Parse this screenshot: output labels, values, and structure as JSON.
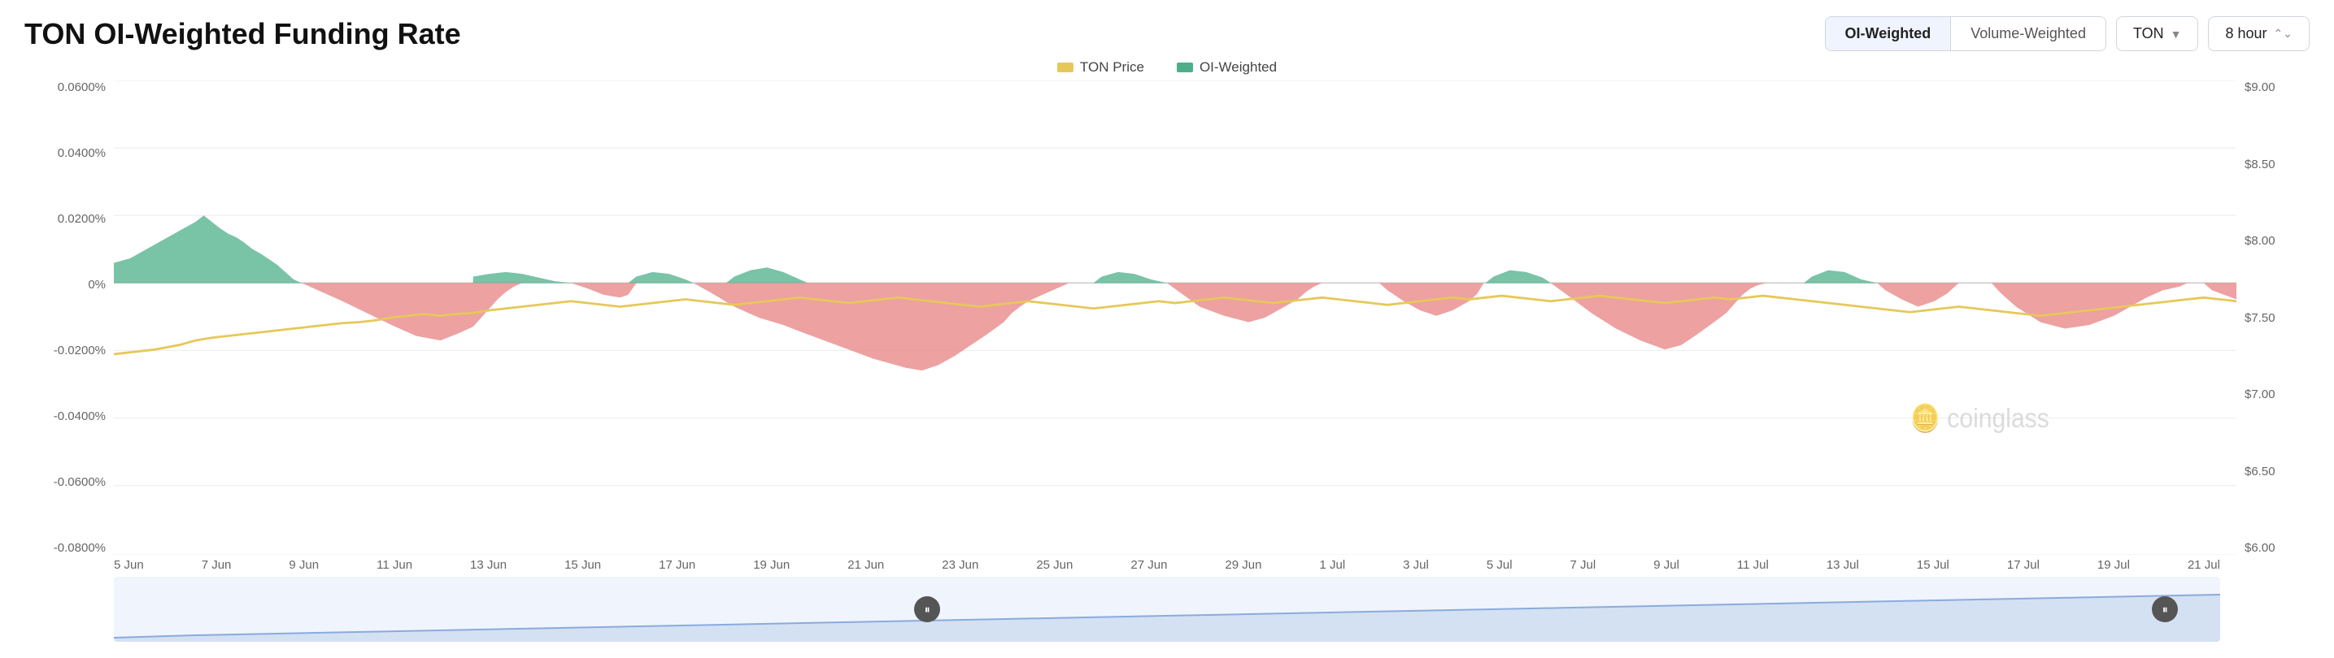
{
  "title": "TON OI-Weighted Funding Rate",
  "controls": {
    "tab_oi": "OI-Weighted",
    "tab_volume": "Volume-Weighted",
    "dropdown_asset": "TON",
    "dropdown_period": "8 hour",
    "active_tab": "oi"
  },
  "legend": {
    "items": [
      {
        "label": "TON Price",
        "color": "#e6c85a"
      },
      {
        "label": "OI-Weighted",
        "color": "#4caf8a"
      }
    ]
  },
  "y_axis_left": [
    "0.0600%",
    "0.0400%",
    "0.0200%",
    "0%",
    "-0.0200%",
    "-0.0400%",
    "-0.0600%",
    "-0.0800%"
  ],
  "y_axis_right": [
    "$9.00",
    "$8.50",
    "$8.00",
    "$7.50",
    "$7.00",
    "$6.50",
    "$6.00"
  ],
  "x_axis": [
    "5 Jun",
    "7 Jun",
    "9 Jun",
    "11 Jun",
    "13 Jun",
    "15 Jun",
    "17 Jun",
    "19 Jun",
    "21 Jun",
    "23 Jun",
    "25 Jun",
    "27 Jun",
    "29 Jun",
    "1 Jul",
    "3 Jul",
    "5 Jul",
    "7 Jul",
    "9 Jul",
    "11 Jul",
    "13 Jul",
    "15 Jul",
    "17 Jul",
    "19 Jul",
    "21 Jul"
  ],
  "watermark": "coinglass"
}
